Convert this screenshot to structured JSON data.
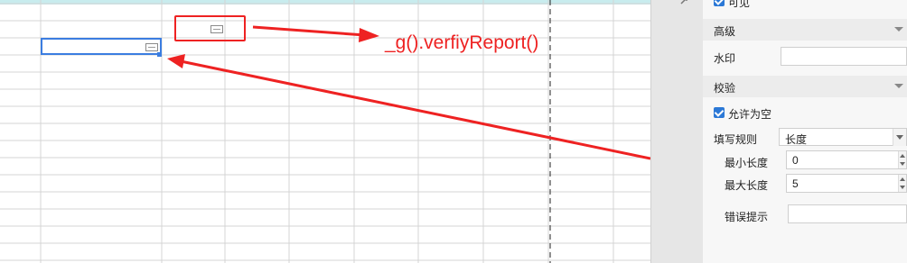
{
  "annotation": {
    "text": "_g().verfiyReport()",
    "color": "#ee2222"
  },
  "sheet": {
    "accent": "#3b7de0"
  },
  "panel": {
    "visible_label": "可见",
    "advanced_header": "高级",
    "watermark_label": "水印",
    "watermark_value": "",
    "validation_header": "校验",
    "allow_empty_label": "允许为空",
    "allow_empty_checked": true,
    "fill_rule_label": "填写规则",
    "fill_rule_value": "长度",
    "min_length_label": "最小长度",
    "min_length_value": "0",
    "max_length_label": "最大长度",
    "max_length_value": "5",
    "error_tip_label": "错误提示",
    "error_tip_value": ""
  },
  "icons": {
    "strip_icon": "link-icon",
    "checkbox": "checkbox-checked-icon",
    "dropdown": "chevron-down-icon",
    "spinner": "spinner-arrows-icon"
  }
}
